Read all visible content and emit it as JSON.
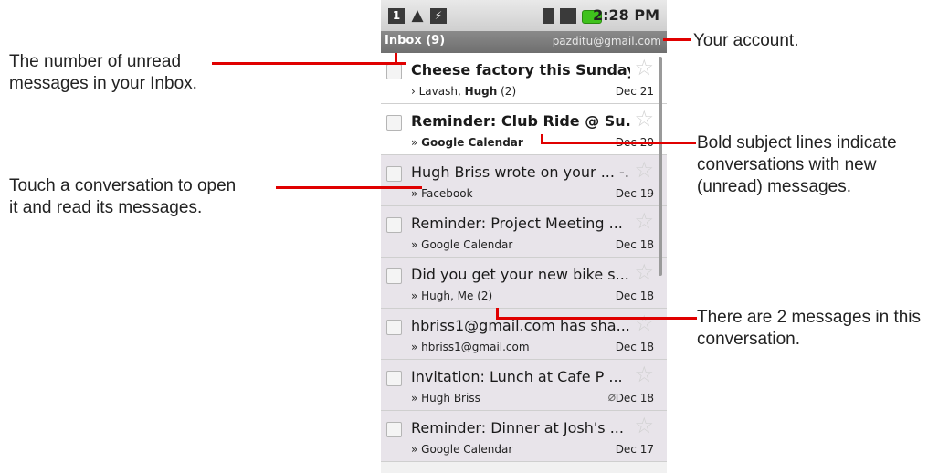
{
  "statusbar": {
    "time": "2:28 PM",
    "left_icons": [
      "1",
      "▲",
      "⚡"
    ],
    "colors": {
      "battery": "#3fc21c"
    }
  },
  "inbox": {
    "label": "Inbox (9)",
    "account": "pazditu@gmail.com"
  },
  "conversations": [
    {
      "subject": "Cheese factory this Sunday",
      "sender_prefix": "› Lavash, ",
      "sender_bold": "Hugh",
      "sender_suffix": " (2)",
      "date": "Dec 21",
      "unread": true,
      "attachment": false
    },
    {
      "subject": "Reminder: Club Ride @ Su...",
      "sender_prefix": "» ",
      "sender_bold": "Google Calendar",
      "sender_suffix": "",
      "date": "Dec 20",
      "unread": true,
      "attachment": false
    },
    {
      "subject": "Hugh Briss wrote on your ... -...",
      "sender_prefix": "» Facebook",
      "sender_bold": "",
      "sender_suffix": "",
      "date": "Dec 19",
      "unread": false,
      "attachment": false
    },
    {
      "subject": "Reminder: Project Meeting ...",
      "sender_prefix": "» Google Calendar",
      "sender_bold": "",
      "sender_suffix": "",
      "date": "Dec 18",
      "unread": false,
      "attachment": false
    },
    {
      "subject": "Did you get your new bike s...",
      "sender_prefix": "» Hugh, Me (2)",
      "sender_bold": "",
      "sender_suffix": "",
      "date": "Dec 18",
      "unread": false,
      "attachment": false
    },
    {
      "subject": "hbriss1@gmail.com has sha...",
      "sender_prefix": "» hbriss1@gmail.com",
      "sender_bold": "",
      "sender_suffix": "",
      "date": "Dec 18",
      "unread": false,
      "attachment": false
    },
    {
      "subject": "Invitation: Lunch at Cafe P ...",
      "sender_prefix": "» Hugh Briss",
      "sender_bold": "",
      "sender_suffix": "",
      "date": "Dec 18",
      "unread": false,
      "attachment": true
    },
    {
      "subject": "Reminder: Dinner at Josh's ...",
      "sender_prefix": "» Google Calendar",
      "sender_bold": "",
      "sender_suffix": "",
      "date": "Dec 17",
      "unread": false,
      "attachment": false
    }
  ],
  "callouts": {
    "unread_count": "The number of unread\nmessages in your Inbox.",
    "touch": "Touch a conversation to open\nit and read its messages.",
    "account": "Your account.",
    "bold": "Bold subject lines indicate\nconversations with new\n(unread) messages.",
    "count": "There are 2 messages in this\nconversation."
  },
  "colors": {
    "callout_line": "#e00000",
    "unread_row": "#ffffff",
    "read_row": "#e8e4ea"
  }
}
